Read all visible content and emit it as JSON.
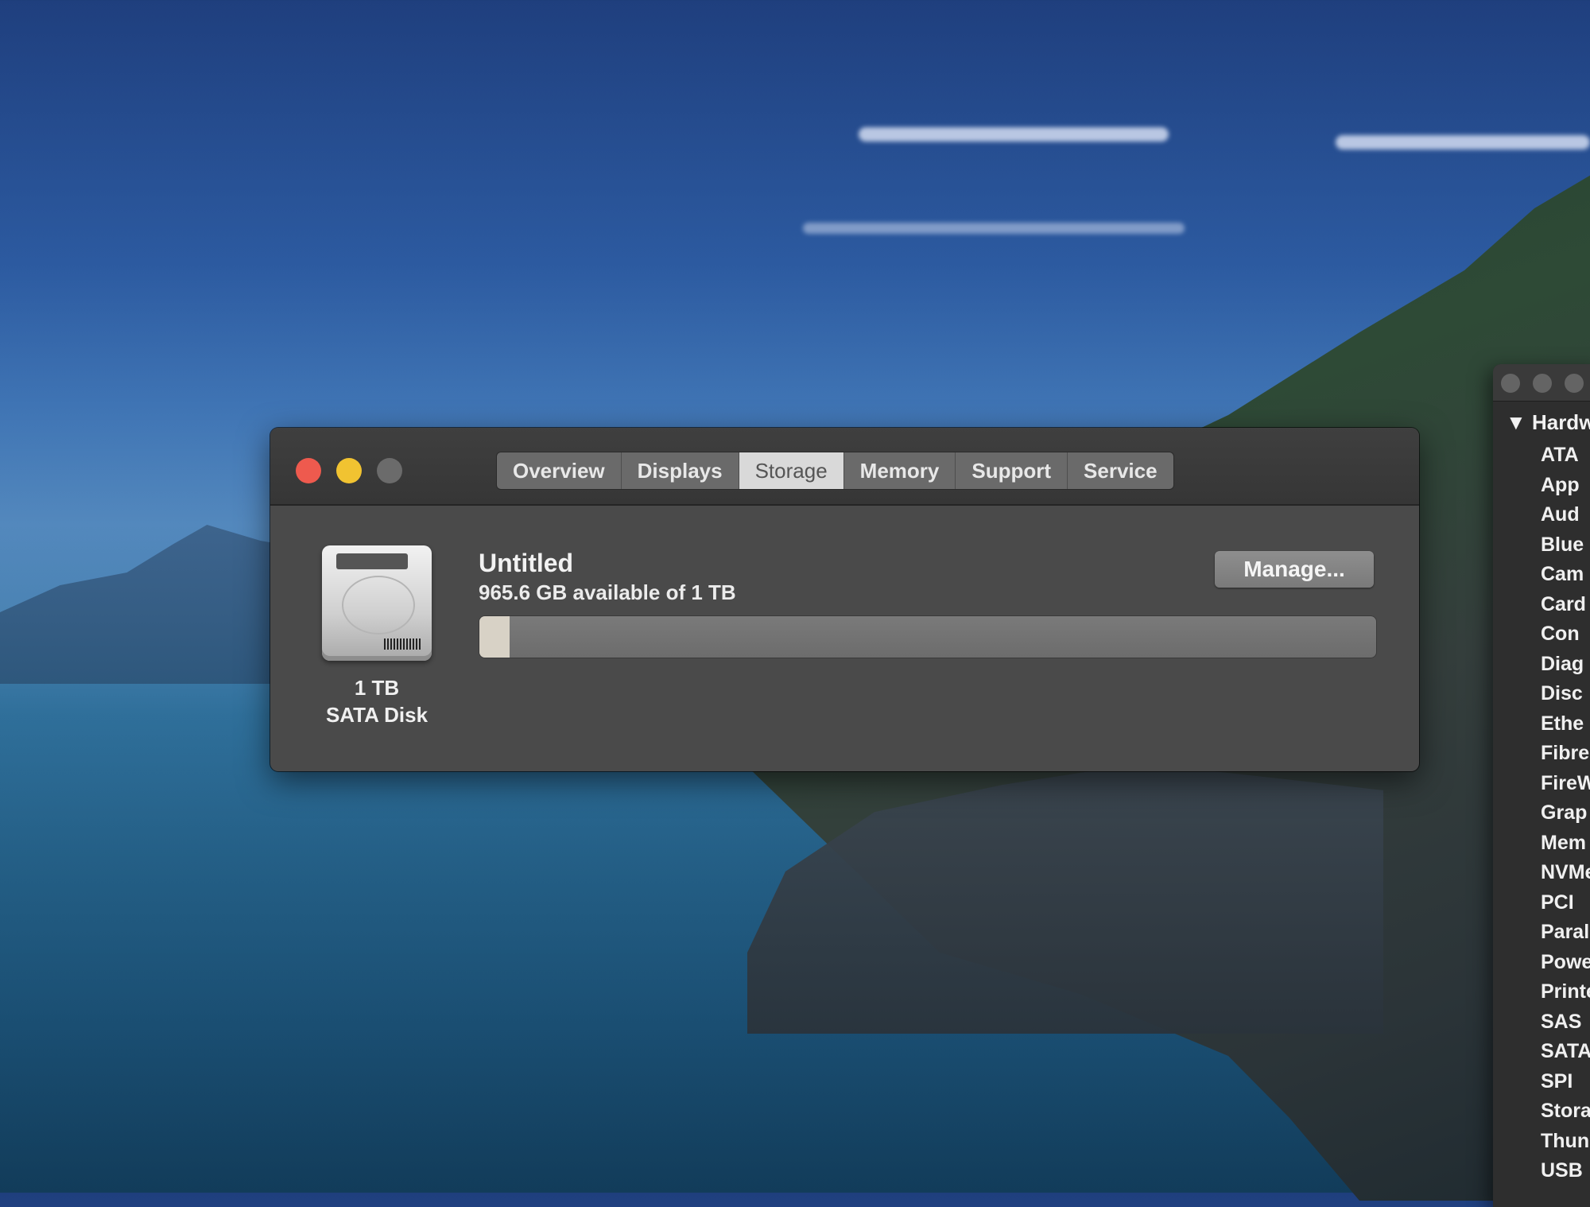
{
  "about_window": {
    "tabs": [
      {
        "label": "Overview"
      },
      {
        "label": "Displays"
      },
      {
        "label": "Storage"
      },
      {
        "label": "Memory"
      },
      {
        "label": "Support"
      },
      {
        "label": "Service"
      }
    ],
    "active_tab": "Storage",
    "disk": {
      "size_label": "1 TB",
      "type_label": "SATA Disk"
    },
    "volume": {
      "name": "Untitled",
      "available_text": "965.6 GB available of 1 TB",
      "used_fraction": 0.034
    },
    "manage_button": "Manage..."
  },
  "system_information": {
    "section_header": "▼ Hardw",
    "items": [
      "ATA",
      "App",
      "Aud",
      "Blue",
      "Cam",
      "Card",
      "Con",
      "Diag",
      "Disc",
      "Ethe",
      "Fibre",
      "FireW",
      "Grap",
      "Mem",
      "NVMe",
      "PCI",
      "Paral",
      "Powe",
      "Printe",
      "SAS",
      "SATA/",
      "SPI",
      "Storag",
      "Thund",
      "USB"
    ]
  },
  "colors": {
    "close": "#ee5a4e",
    "minimize": "#f1c331",
    "zoom_disabled": "#6b6b6b",
    "storage_fill": "#d8d2c6"
  }
}
